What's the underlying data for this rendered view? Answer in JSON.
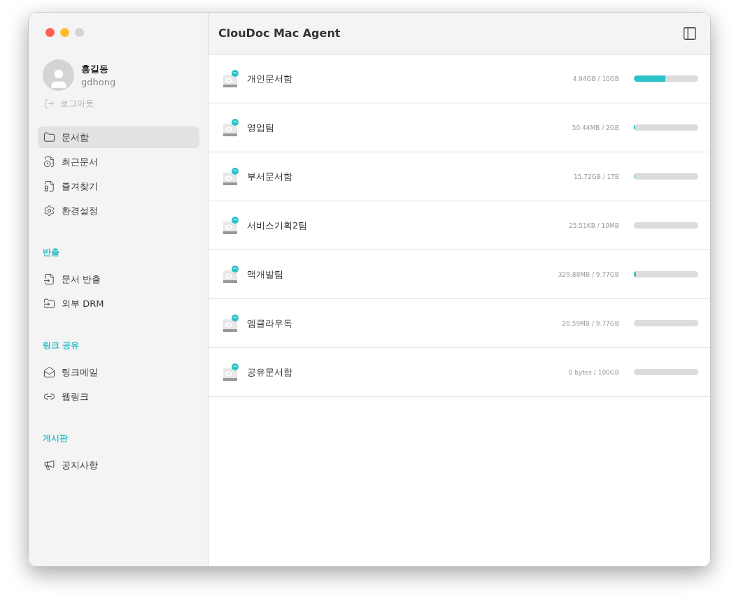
{
  "window": {
    "title": "ClouDoc Mac Agent"
  },
  "user": {
    "name": "홍길동",
    "id": "gdhong",
    "logout": "로그아웃"
  },
  "sidebar": {
    "sections": [
      {
        "items": [
          {
            "label": "문서함",
            "selected": true
          },
          {
            "label": "최근문서",
            "selected": false
          },
          {
            "label": "즐겨찾기",
            "selected": false
          },
          {
            "label": "환경설정",
            "selected": false
          }
        ]
      },
      {
        "title": "반출",
        "items": [
          {
            "label": "문서 반출",
            "selected": false
          },
          {
            "label": "외부 DRM",
            "selected": false
          }
        ]
      },
      {
        "title": "링크 공유",
        "items": [
          {
            "label": "링크메일",
            "selected": false
          },
          {
            "label": "웹링크",
            "selected": false
          }
        ]
      },
      {
        "title": "게시판",
        "items": [
          {
            "label": "공지사항",
            "selected": false
          }
        ]
      }
    ]
  },
  "drives": [
    {
      "name": "개인문서함",
      "usage": "4.94GB / 10GB",
      "level": 0.494
    },
    {
      "name": "영업팀",
      "usage": "50.44MB / 2GB",
      "level": 0.02
    },
    {
      "name": "부서문서함",
      "usage": "15.72GB / 1TB",
      "level": 0.015
    },
    {
      "name": "서비스기획2팀",
      "usage": "25.51KB / 10MB"
    },
    {
      "name": "맥개발팀",
      "usage": "329.88MB / 9.77GB",
      "level": 0.033
    },
    {
      "name": "엠클라우독",
      "usage": "20.59MB / 9.77GB"
    },
    {
      "name": "공유문서함",
      "usage": "0 bytes / 100GB"
    }
  ]
}
